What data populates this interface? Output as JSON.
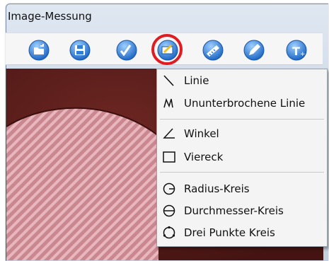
{
  "window": {
    "title": "Image-Messung"
  },
  "toolbar": {
    "buttons": [
      {
        "name": "open-icon"
      },
      {
        "name": "save-icon"
      },
      {
        "name": "checkmark-icon"
      },
      {
        "name": "measure-tool-icon",
        "highlighted": true
      },
      {
        "name": "ruler-icon"
      },
      {
        "name": "pencil-icon"
      },
      {
        "name": "text-icon",
        "glyph": "T"
      }
    ]
  },
  "menu": {
    "items": [
      {
        "label": "Linie",
        "icon": "line-icon"
      },
      {
        "label": "Ununterbrochene Linie",
        "icon": "polyline-icon"
      },
      {
        "label": "Winkel",
        "icon": "angle-icon"
      },
      {
        "label": "Viereck",
        "icon": "rectangle-icon"
      },
      {
        "label": "Radius-Kreis",
        "icon": "radius-circle-icon"
      },
      {
        "label": "Durchmesser-Kreis",
        "icon": "diameter-circle-icon"
      },
      {
        "label": "Drei Punkte Kreis",
        "icon": "three-point-circle-icon"
      }
    ]
  },
  "colors": {
    "highlight_ring": "#e01b22",
    "toolbar_icon": "#2f7fd6",
    "image_dark": "#5b1d1a",
    "image_stripes": "#d79aa0"
  }
}
